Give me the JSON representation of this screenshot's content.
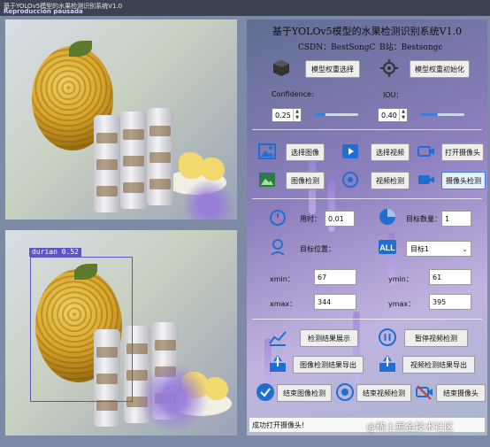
{
  "window": {
    "title": "基于YOLOv5模型的水果检测识别系统V1.0",
    "overlay_text": "Reproducción pausada"
  },
  "detection": {
    "label": "durian 0.52",
    "box_color": "#5a56c4"
  },
  "header": {
    "title": "基于YOLOv5模型的水果检测识别系统V1.0",
    "csdn": "CSDN：BestSongC",
    "bilibili": "B站：Bestsongc"
  },
  "model": {
    "select_label": "模型权重选择",
    "init_label": "模型权重初始化"
  },
  "params": {
    "confidence_label": "Confidence:",
    "iou_label": "IOU：",
    "confidence_value": "0.25",
    "iou_value": "0.40",
    "confidence_level": 0.25,
    "iou_level": 0.4
  },
  "actions": {
    "select_image": "选择图像",
    "select_video": "选择视频",
    "open_camera": "打开摄像头",
    "image_detect": "图像检测",
    "video_detect": "视频检测",
    "camera_detect": "摄像头检测"
  },
  "stats": {
    "time_label": "用时：",
    "time_value": "0.01",
    "count_label": "目标数量：",
    "count_value": "1",
    "position_label": "目标位置：",
    "target_select": "目标1",
    "xmin_label": "xmin：",
    "xmin_value": "67",
    "ymin_label": "ymin：",
    "ymin_value": "61",
    "xmax_label": "xmax：",
    "xmax_value": "344",
    "ymax_label": "ymax：",
    "ymax_value": "395"
  },
  "results": {
    "show": "检测结果展示",
    "pause_video": "暂停视频检测",
    "export_image": "图像检测结果导出",
    "export_video": "视频检测结果导出",
    "end_image": "结束图像检测",
    "end_video": "结束视频检测",
    "end_camera": "结束摄像头"
  },
  "status": {
    "message": "成功打开摄像头!"
  },
  "watermark": {
    "text": "@稀土掘金技术社区"
  },
  "colors": {
    "accent": "#3c7dd9",
    "button_bg": "#eeeeee"
  }
}
